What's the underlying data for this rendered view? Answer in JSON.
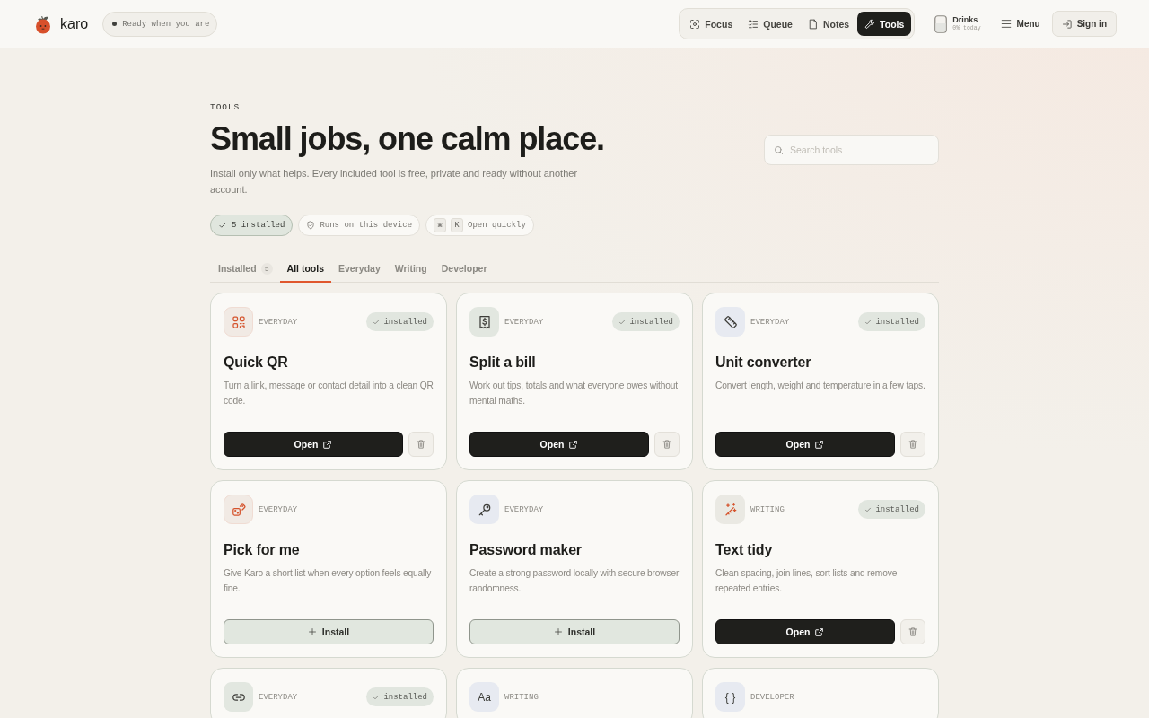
{
  "header": {
    "brand": "karo",
    "status": "Ready when you are",
    "nav": [
      {
        "label": "Focus",
        "selected": false
      },
      {
        "label": "Queue",
        "selected": false
      },
      {
        "label": "Notes",
        "selected": false
      },
      {
        "label": "Tools",
        "selected": true
      }
    ],
    "drinks": {
      "label": "Drinks",
      "today": "0% today"
    },
    "menu": "Menu",
    "sign_in": "Sign in"
  },
  "hero": {
    "eyebrow": "TOOLS",
    "title": "Small jobs, one calm place.",
    "subtitle": "Install only what helps. Every included tool is free, private and ready without another account.",
    "search": {
      "placeholder": "Search tools"
    },
    "chips": [
      {
        "kind": "count",
        "label": "5 installed"
      },
      {
        "kind": "privacy",
        "label": "Runs on this device"
      },
      {
        "kind": "shortcut",
        "keys": [
          "⌘",
          "K"
        ],
        "label": "Open quickly"
      }
    ]
  },
  "tabs": [
    {
      "label": "Installed",
      "count": "5",
      "selected": false
    },
    {
      "label": "All tools",
      "selected": true
    },
    {
      "label": "Everyday",
      "selected": false
    },
    {
      "label": "Writing",
      "selected": false
    },
    {
      "label": "Developer",
      "selected": false
    }
  ],
  "tools": [
    {
      "category": "EVERYDAY",
      "installed": true,
      "badge": "installed",
      "title": "Quick QR",
      "description": "Turn a link, message or contact detail into a clean QR code.",
      "button": "Open"
    },
    {
      "category": "EVERYDAY",
      "installed": true,
      "badge": "installed",
      "title": "Split a bill",
      "description": "Work out tips, totals and what everyone owes without mental maths.",
      "button": "Open"
    },
    {
      "category": "EVERYDAY",
      "installed": true,
      "badge": "installed",
      "title": "Unit converter",
      "description": "Convert length, weight and temperature in a few taps.",
      "button": "Open"
    },
    {
      "category": "EVERYDAY",
      "installed": false,
      "title": "Pick for me",
      "description": "Give Karo a short list when every option feels equally fine.",
      "button": "Install"
    },
    {
      "category": "EVERYDAY",
      "installed": false,
      "title": "Password maker",
      "description": "Create a strong password locally with secure browser randomness.",
      "button": "Install"
    },
    {
      "category": "WRITING",
      "installed": true,
      "badge": "installed",
      "title": "Text tidy",
      "description": "Clean spacing, join lines, sort lists and remove repeated entries.",
      "button": "Open"
    },
    {
      "category": "EVERYDAY",
      "installed": true,
      "badge": "installed"
    },
    {
      "category": "WRITING",
      "glyph": "Aa"
    },
    {
      "category": "DEVELOPER",
      "glyph": "{ }"
    }
  ]
}
